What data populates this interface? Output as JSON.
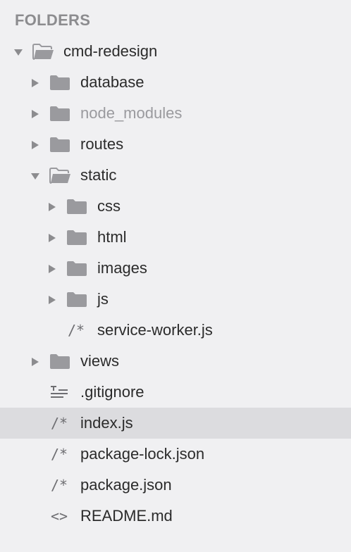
{
  "sidebar": {
    "header": "FOLDERS",
    "colors": {
      "background": "#f0f0f2",
      "selected_row": "#dcdcdf",
      "folder_icon": "#9a9a9e",
      "text": "#2b2b2b",
      "dim_text": "#9a9a9e"
    },
    "items": [
      {
        "label": "cmd-redesign",
        "kind": "folder",
        "expanded": true,
        "depth": 0,
        "icon": "folder-open-icon"
      },
      {
        "label": "database",
        "kind": "folder",
        "expanded": false,
        "depth": 1,
        "icon": "folder-icon"
      },
      {
        "label": "node_modules",
        "kind": "folder",
        "expanded": false,
        "depth": 1,
        "icon": "folder-icon",
        "dimmed": true
      },
      {
        "label": "routes",
        "kind": "folder",
        "expanded": false,
        "depth": 1,
        "icon": "folder-icon"
      },
      {
        "label": "static",
        "kind": "folder",
        "expanded": true,
        "depth": 1,
        "icon": "folder-open-icon"
      },
      {
        "label": "css",
        "kind": "folder",
        "expanded": false,
        "depth": 2,
        "icon": "folder-icon"
      },
      {
        "label": "html",
        "kind": "folder",
        "expanded": false,
        "depth": 2,
        "icon": "folder-icon"
      },
      {
        "label": "images",
        "kind": "folder",
        "expanded": false,
        "depth": 2,
        "icon": "folder-icon"
      },
      {
        "label": "js",
        "kind": "folder",
        "expanded": false,
        "depth": 2,
        "icon": "folder-icon"
      },
      {
        "label": "service-worker.js",
        "kind": "file",
        "depth": 2,
        "icon": "js-file-icon",
        "glyph": "/*"
      },
      {
        "label": "views",
        "kind": "folder",
        "expanded": false,
        "depth": 1,
        "icon": "folder-icon"
      },
      {
        "label": ".gitignore",
        "kind": "file",
        "depth": 1,
        "icon": "text-file-icon"
      },
      {
        "label": "index.js",
        "kind": "file",
        "depth": 1,
        "icon": "js-file-icon",
        "glyph": "/*",
        "selected": true
      },
      {
        "label": "package-lock.json",
        "kind": "file",
        "depth": 1,
        "icon": "js-file-icon",
        "glyph": "/*"
      },
      {
        "label": "package.json",
        "kind": "file",
        "depth": 1,
        "icon": "js-file-icon",
        "glyph": "/*"
      },
      {
        "label": "README.md",
        "kind": "file",
        "depth": 1,
        "icon": "code-file-icon",
        "glyph": "<>"
      }
    ]
  }
}
